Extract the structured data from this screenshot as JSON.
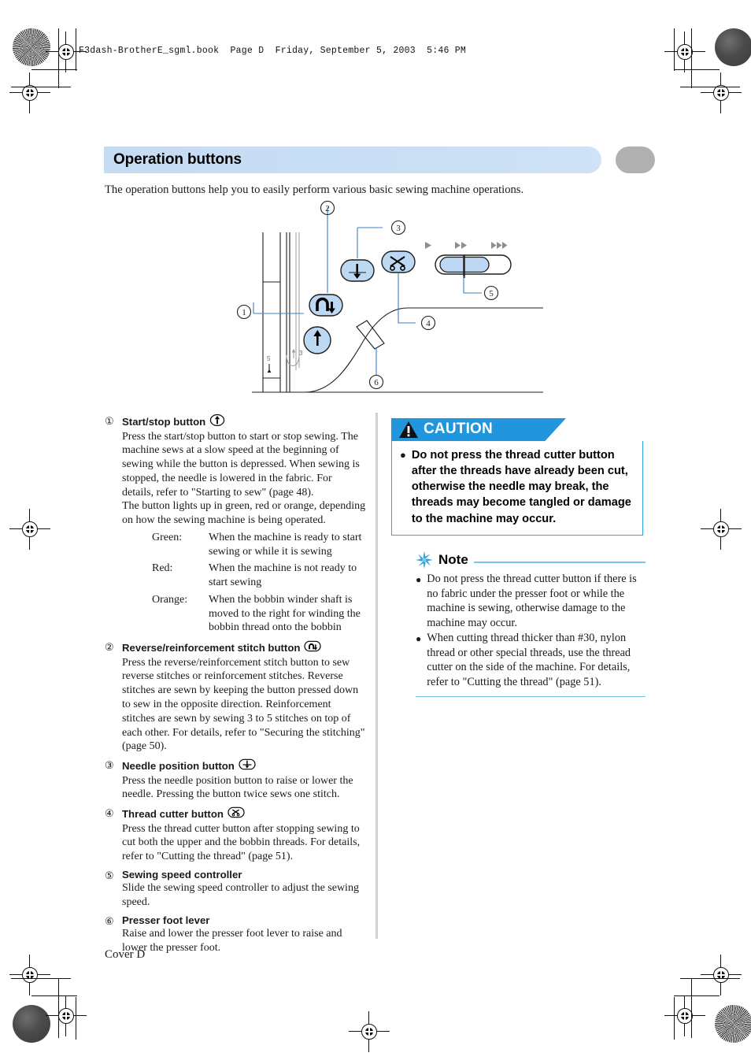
{
  "page": {
    "running_header": "F3dash-BrotherE_sgml.book  Page D  Friday, September 5, 2003  5:46 PM",
    "footer": "Cover D",
    "accent_blue": "#c6dcf3",
    "caution_blue": "#2196dd",
    "note_rule_blue": "#74c6ec",
    "title_cap_gray": "#b0b0b0"
  },
  "section": {
    "title": "Operation buttons",
    "intro": "The operation buttons help you to easily perform various basic sewing machine operations."
  },
  "diagram": {
    "callouts": [
      "①",
      "②",
      "③",
      "④",
      "⑤",
      "⑥"
    ],
    "scale_labels": [
      "5",
      "3"
    ],
    "speed_markers": [
      "▶",
      "▶▶",
      "▶▶▶"
    ]
  },
  "items": [
    {
      "num": "①",
      "title": "Start/stop button",
      "icon": "start-stop-button-icon",
      "body": "Press the start/stop button to start or stop sewing. The machine sews at a slow speed at the beginning of sewing while the button is depressed. When sewing is stopped, the needle is lowered in the fabric. For details, refer to \"Starting to sew\" (page 48).",
      "body2": "The button lights up in green, red or orange, depending on how the sewing machine is being operated.",
      "definitions": [
        {
          "key": "Green:",
          "value": "When the machine is ready to start sewing or while it is sewing"
        },
        {
          "key": "Red:",
          "value": "When the machine is not ready to start sewing"
        },
        {
          "key": "Orange:",
          "value": "When the bobbin winder shaft is moved to the right for winding the bobbin thread onto the bobbin"
        }
      ]
    },
    {
      "num": "②",
      "title": "Reverse/reinforcement stitch button",
      "icon": "reverse-stitch-button-icon",
      "body": "Press the reverse/reinforcement stitch button to sew reverse stitches or reinforcement stitches. Reverse stitches are sewn by keeping the button pressed down to sew in the opposite direction. Reinforcement stitches are sewn by sewing 3 to 5 stitches on top of each other. For details, refer to \"Securing the stitching\" (page 50)."
    },
    {
      "num": "③",
      "title": "Needle position button",
      "icon": "needle-position-button-icon",
      "body": "Press the needle position button to raise or lower the needle. Pressing the button twice sews one stitch."
    },
    {
      "num": "④",
      "title": "Thread cutter button",
      "icon": "thread-cutter-button-icon",
      "body": "Press the thread cutter button after stopping sewing to cut both the upper and the bobbin threads. For details, refer to \"Cutting the thread\" (page 51)."
    },
    {
      "num": "⑤",
      "title": "Sewing speed controller",
      "icon": "",
      "body": "Slide the sewing speed controller to adjust the sewing speed."
    },
    {
      "num": "⑥",
      "title": "Presser foot lever",
      "icon": "",
      "body": "Raise and lower the presser foot lever to raise and lower the presser foot."
    }
  ],
  "caution": {
    "label": "CAUTION",
    "bullet": "●",
    "text": "Do not press the thread cutter button after the threads have already been cut, otherwise the needle may break, the threads may become tangled or damage to the machine may occur."
  },
  "note": {
    "label": "Note",
    "bullet": "●",
    "items": [
      "Do not press the thread cutter button if there is no fabric under the presser foot or while the machine is sewing, otherwise damage to the machine may occur.",
      "When cutting thread thicker than #30, nylon thread or other special threads, use the thread cutter on the side of the machine. For details, refer to \"Cutting the thread\" (page 51)."
    ]
  }
}
